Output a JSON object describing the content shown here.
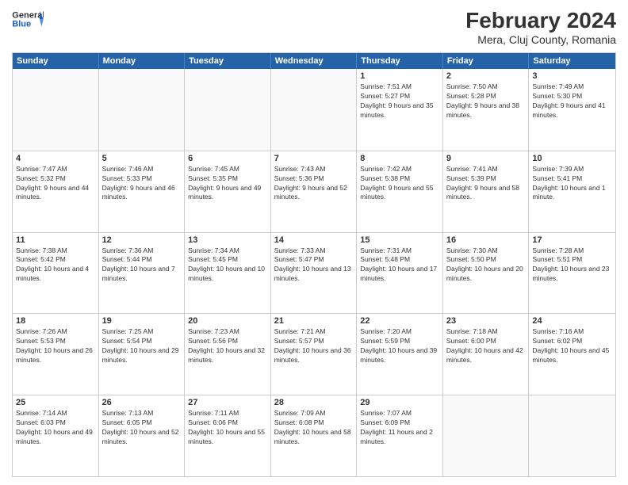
{
  "header": {
    "logo_general": "General",
    "logo_blue": "Blue",
    "month_title": "February 2024",
    "location": "Mera, Cluj County, Romania"
  },
  "weekdays": [
    "Sunday",
    "Monday",
    "Tuesday",
    "Wednesday",
    "Thursday",
    "Friday",
    "Saturday"
  ],
  "weeks": [
    [
      {
        "day": "",
        "sunrise": "",
        "sunset": "",
        "daylight": "",
        "empty": true
      },
      {
        "day": "",
        "sunrise": "",
        "sunset": "",
        "daylight": "",
        "empty": true
      },
      {
        "day": "",
        "sunrise": "",
        "sunset": "",
        "daylight": "",
        "empty": true
      },
      {
        "day": "",
        "sunrise": "",
        "sunset": "",
        "daylight": "",
        "empty": true
      },
      {
        "day": "1",
        "sunrise": "Sunrise: 7:51 AM",
        "sunset": "Sunset: 5:27 PM",
        "daylight": "Daylight: 9 hours and 35 minutes.",
        "empty": false
      },
      {
        "day": "2",
        "sunrise": "Sunrise: 7:50 AM",
        "sunset": "Sunset: 5:28 PM",
        "daylight": "Daylight: 9 hours and 38 minutes.",
        "empty": false
      },
      {
        "day": "3",
        "sunrise": "Sunrise: 7:49 AM",
        "sunset": "Sunset: 5:30 PM",
        "daylight": "Daylight: 9 hours and 41 minutes.",
        "empty": false
      }
    ],
    [
      {
        "day": "4",
        "sunrise": "Sunrise: 7:47 AM",
        "sunset": "Sunset: 5:32 PM",
        "daylight": "Daylight: 9 hours and 44 minutes.",
        "empty": false
      },
      {
        "day": "5",
        "sunrise": "Sunrise: 7:46 AM",
        "sunset": "Sunset: 5:33 PM",
        "daylight": "Daylight: 9 hours and 46 minutes.",
        "empty": false
      },
      {
        "day": "6",
        "sunrise": "Sunrise: 7:45 AM",
        "sunset": "Sunset: 5:35 PM",
        "daylight": "Daylight: 9 hours and 49 minutes.",
        "empty": false
      },
      {
        "day": "7",
        "sunrise": "Sunrise: 7:43 AM",
        "sunset": "Sunset: 5:36 PM",
        "daylight": "Daylight: 9 hours and 52 minutes.",
        "empty": false
      },
      {
        "day": "8",
        "sunrise": "Sunrise: 7:42 AM",
        "sunset": "Sunset: 5:38 PM",
        "daylight": "Daylight: 9 hours and 55 minutes.",
        "empty": false
      },
      {
        "day": "9",
        "sunrise": "Sunrise: 7:41 AM",
        "sunset": "Sunset: 5:39 PM",
        "daylight": "Daylight: 9 hours and 58 minutes.",
        "empty": false
      },
      {
        "day": "10",
        "sunrise": "Sunrise: 7:39 AM",
        "sunset": "Sunset: 5:41 PM",
        "daylight": "Daylight: 10 hours and 1 minute.",
        "empty": false
      }
    ],
    [
      {
        "day": "11",
        "sunrise": "Sunrise: 7:38 AM",
        "sunset": "Sunset: 5:42 PM",
        "daylight": "Daylight: 10 hours and 4 minutes.",
        "empty": false
      },
      {
        "day": "12",
        "sunrise": "Sunrise: 7:36 AM",
        "sunset": "Sunset: 5:44 PM",
        "daylight": "Daylight: 10 hours and 7 minutes.",
        "empty": false
      },
      {
        "day": "13",
        "sunrise": "Sunrise: 7:34 AM",
        "sunset": "Sunset: 5:45 PM",
        "daylight": "Daylight: 10 hours and 10 minutes.",
        "empty": false
      },
      {
        "day": "14",
        "sunrise": "Sunrise: 7:33 AM",
        "sunset": "Sunset: 5:47 PM",
        "daylight": "Daylight: 10 hours and 13 minutes.",
        "empty": false
      },
      {
        "day": "15",
        "sunrise": "Sunrise: 7:31 AM",
        "sunset": "Sunset: 5:48 PM",
        "daylight": "Daylight: 10 hours and 17 minutes.",
        "empty": false
      },
      {
        "day": "16",
        "sunrise": "Sunrise: 7:30 AM",
        "sunset": "Sunset: 5:50 PM",
        "daylight": "Daylight: 10 hours and 20 minutes.",
        "empty": false
      },
      {
        "day": "17",
        "sunrise": "Sunrise: 7:28 AM",
        "sunset": "Sunset: 5:51 PM",
        "daylight": "Daylight: 10 hours and 23 minutes.",
        "empty": false
      }
    ],
    [
      {
        "day": "18",
        "sunrise": "Sunrise: 7:26 AM",
        "sunset": "Sunset: 5:53 PM",
        "daylight": "Daylight: 10 hours and 26 minutes.",
        "empty": false
      },
      {
        "day": "19",
        "sunrise": "Sunrise: 7:25 AM",
        "sunset": "Sunset: 5:54 PM",
        "daylight": "Daylight: 10 hours and 29 minutes.",
        "empty": false
      },
      {
        "day": "20",
        "sunrise": "Sunrise: 7:23 AM",
        "sunset": "Sunset: 5:56 PM",
        "daylight": "Daylight: 10 hours and 32 minutes.",
        "empty": false
      },
      {
        "day": "21",
        "sunrise": "Sunrise: 7:21 AM",
        "sunset": "Sunset: 5:57 PM",
        "daylight": "Daylight: 10 hours and 36 minutes.",
        "empty": false
      },
      {
        "day": "22",
        "sunrise": "Sunrise: 7:20 AM",
        "sunset": "Sunset: 5:59 PM",
        "daylight": "Daylight: 10 hours and 39 minutes.",
        "empty": false
      },
      {
        "day": "23",
        "sunrise": "Sunrise: 7:18 AM",
        "sunset": "Sunset: 6:00 PM",
        "daylight": "Daylight: 10 hours and 42 minutes.",
        "empty": false
      },
      {
        "day": "24",
        "sunrise": "Sunrise: 7:16 AM",
        "sunset": "Sunset: 6:02 PM",
        "daylight": "Daylight: 10 hours and 45 minutes.",
        "empty": false
      }
    ],
    [
      {
        "day": "25",
        "sunrise": "Sunrise: 7:14 AM",
        "sunset": "Sunset: 6:03 PM",
        "daylight": "Daylight: 10 hours and 49 minutes.",
        "empty": false
      },
      {
        "day": "26",
        "sunrise": "Sunrise: 7:13 AM",
        "sunset": "Sunset: 6:05 PM",
        "daylight": "Daylight: 10 hours and 52 minutes.",
        "empty": false
      },
      {
        "day": "27",
        "sunrise": "Sunrise: 7:11 AM",
        "sunset": "Sunset: 6:06 PM",
        "daylight": "Daylight: 10 hours and 55 minutes.",
        "empty": false
      },
      {
        "day": "28",
        "sunrise": "Sunrise: 7:09 AM",
        "sunset": "Sunset: 6:08 PM",
        "daylight": "Daylight: 10 hours and 58 minutes.",
        "empty": false
      },
      {
        "day": "29",
        "sunrise": "Sunrise: 7:07 AM",
        "sunset": "Sunset: 6:09 PM",
        "daylight": "Daylight: 11 hours and 2 minutes.",
        "empty": false
      },
      {
        "day": "",
        "sunrise": "",
        "sunset": "",
        "daylight": "",
        "empty": true
      },
      {
        "day": "",
        "sunrise": "",
        "sunset": "",
        "daylight": "",
        "empty": true
      }
    ]
  ]
}
